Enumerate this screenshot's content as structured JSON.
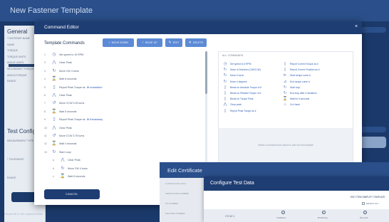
{
  "background_window": {
    "title": "New Fastener Template",
    "section_general": "General",
    "section_test_config": "Test Config",
    "left_labels": [
      "* FASTENER NAME",
      "NAME",
      "TORQUE",
      "TORQUE UNITS",
      "ANGLE UNITS",
      "SECONDARY TORQUE",
      "ANGLE/TORQUE",
      "RANGE"
    ],
    "test_config_labels": [
      "MEASUREMENT TYPE",
      "* TOLERANCE",
      "RANGE"
    ],
    "footer_text": "Please fill in the required fields"
  },
  "command_editor": {
    "title": "Command Editor",
    "close_glyph": "×",
    "template_commands_title": "Template Commands",
    "toolbar": {
      "move_down": "MOVE DOWN",
      "move_up": "MOVE UP",
      "edit": "EDIT",
      "delete": "DELETE"
    },
    "template_commands": [
      {
        "num": "1",
        "icon": "◷",
        "text": "Set speed to 10 RPM",
        "link": ""
      },
      {
        "num": "2",
        "icon": "⋀",
        "text": "Clear Peak",
        "link": ""
      },
      {
        "num": "3",
        "icon": "↻",
        "text": "Move CW 4 turns",
        "link": ""
      },
      {
        "num": "4",
        "icon": "⌛",
        "text": "Wait 8 seconds",
        "link": ""
      },
      {
        "num": "5",
        "icon": "▯",
        "text": "Report Peak Torque as",
        "link": "Nt Installation"
      },
      {
        "num": "6",
        "icon": "⋀",
        "text": "Clear Peak",
        "link": ""
      },
      {
        "num": "7",
        "icon": "↺",
        "text": "Move CCW 0.25 turns",
        "link": ""
      },
      {
        "num": "8",
        "icon": "⌛",
        "text": "Wait 5 seconds",
        "link": ""
      },
      {
        "num": "9",
        "icon": "▯",
        "text": "Report Peak Torque as",
        "link": "Nt Breakaway"
      },
      {
        "num": "10",
        "icon": "⋀",
        "text": "Clear Peak",
        "link": ""
      },
      {
        "num": "11",
        "icon": "↺",
        "text": "Move CCW 3.75 turns",
        "link": ""
      },
      {
        "num": "12",
        "icon": "⌛",
        "text": "Wait 4 seconds",
        "link": ""
      },
      {
        "num": "13",
        "icon": "↻",
        "text": "Start Loop",
        "link": ""
      },
      {
        "num": "a",
        "icon": "⋀",
        "text": "Clear Peak",
        "link": ""
      },
      {
        "num": "b",
        "icon": "↻",
        "text": "Move CW 4 turns",
        "link": ""
      },
      {
        "num": "c",
        "icon": "⌛",
        "text": "Wait 8 seconds",
        "link": ""
      }
    ],
    "all_commands_title": "ALL COMMANDS",
    "all_commands_left": [
      {
        "icon": "◷",
        "text": "Set speed to # RPM"
      },
      {
        "icon": "↻",
        "text": "Move in Direction (CW/CCW)"
      },
      {
        "icon": "↻",
        "text": "Move # turns"
      },
      {
        "icon": "↻",
        "text": "Move # degrees"
      },
      {
        "icon": "▯",
        "text": "Break on Absolute Torque of #"
      },
      {
        "icon": "▯",
        "text": "Break on Relative Torque of #"
      },
      {
        "icon": "▯",
        "text": "Break on Torque Peak"
      },
      {
        "icon": "⋀",
        "text": "Clear peak"
      },
      {
        "icon": "▯",
        "text": "Report Peak Torque as #"
      }
    ],
    "all_commands_right": [
      {
        "icon": "▯",
        "text": "Report Current Torque as #"
      },
      {
        "icon": "▯",
        "text": "Report Current Position as #"
      },
      {
        "icon": "⊳",
        "text": "Start torque curve #"
      },
      {
        "icon": "⊿",
        "text": "End torque curve #"
      },
      {
        "icon": "↻",
        "text": "Start loop"
      },
      {
        "icon": "↻",
        "text": "End loop after # iterations"
      },
      {
        "icon": "⌛",
        "text": "Wait for # seconds"
      },
      {
        "icon": "⌂",
        "text": "Go Home"
      }
    ],
    "drop_zone_text": "Select a command from above to add it to the template",
    "cancel_label": "CANCEL"
  },
  "edit_certificate": {
    "title": "Edit Certificate",
    "labels": [
      "Certificate Information",
      "CERTIFICATE NUMBER",
      "PO NUMBER",
      "MACHINE NUMBER"
    ]
  },
  "configure_test_data": {
    "title": "Configure Test Data",
    "link": "EDIT ITEM SIMPLIFY TEMPLATE",
    "select_all": "SELECT ALL",
    "row_label": "CYCLE 1",
    "columns": [
      "Installation",
      "Breakaway",
      "Removal"
    ]
  },
  "colors": {
    "navy": "#1e3d73",
    "accent_blue": "#5c8ad6",
    "link_blue": "#2f5fb3"
  }
}
